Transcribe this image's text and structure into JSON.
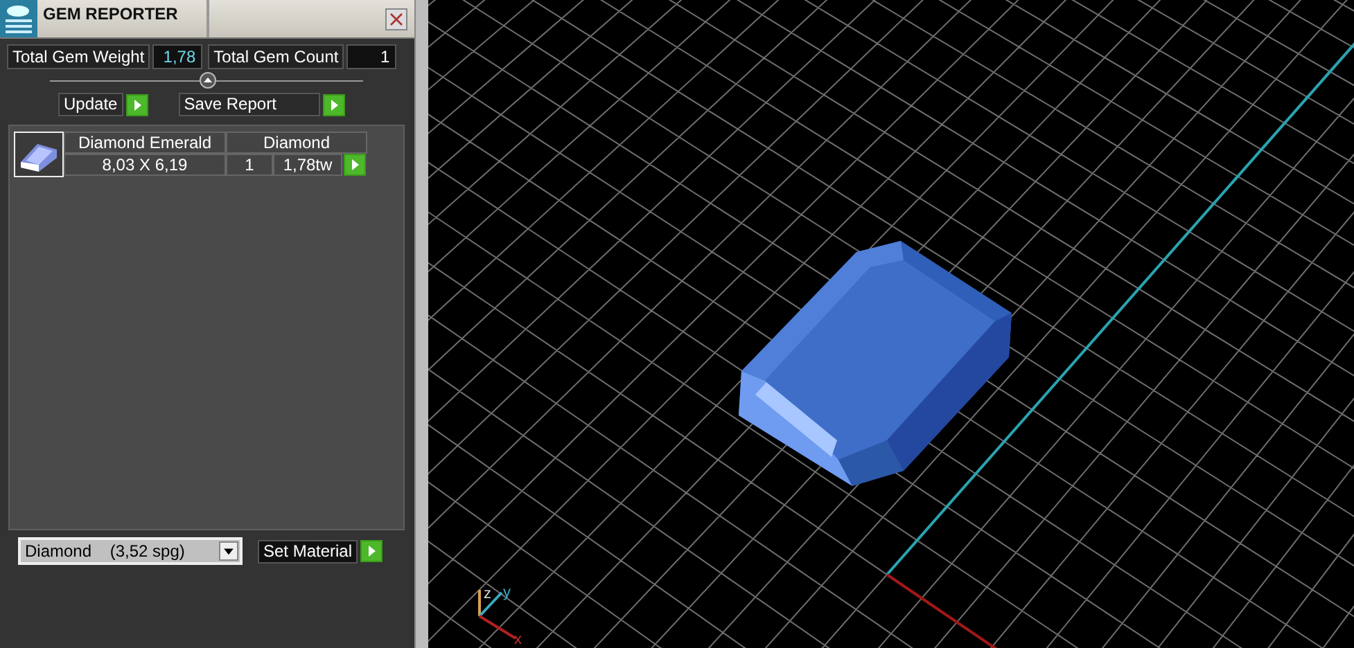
{
  "panel": {
    "title": "GEM REPORTER",
    "stats": [
      {
        "label": "Total Gem Weight",
        "value": "1,78"
      },
      {
        "label": "Total Gem Count",
        "value": "1"
      }
    ],
    "buttons": [
      "Update",
      "Save Report"
    ],
    "gems": [
      {
        "name": "Diamond Emerald",
        "material": "Diamond",
        "size": "8,03 X 6,19",
        "count": "1",
        "weight": "1,78tw"
      }
    ],
    "material_select": {
      "value": "Diamond    (3,52 spg)"
    },
    "set_material_button": "Set Material"
  },
  "viewport": {
    "axis_labels": [
      "z",
      "y",
      "x"
    ]
  }
}
